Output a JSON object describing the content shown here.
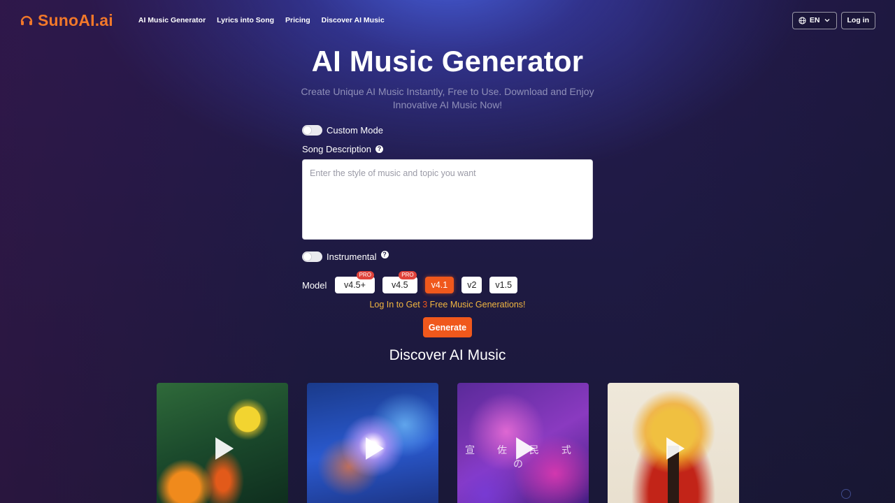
{
  "brand": {
    "name": "SunoAI.ai",
    "accent": "#f2782a"
  },
  "nav": {
    "links": [
      "AI Music Generator",
      "Lyrics into Song",
      "Pricing",
      "Discover AI Music"
    ],
    "lang": "EN",
    "login": "Log in"
  },
  "hero": {
    "title": "AI Music Generator",
    "subtitle": "Create Unique AI Music Instantly, Free to Use. Download and Enjoy Innovative AI Music Now!"
  },
  "form": {
    "custom_mode_label": "Custom Mode",
    "custom_mode_on": false,
    "song_description_label": "Song Description",
    "song_description_placeholder": "Enter the style of music and topic you want",
    "song_description_value": "",
    "instrumental_label": "Instrumental",
    "instrumental_on": false,
    "model_label": "Model",
    "models": [
      {
        "label": "v4.5+",
        "badge": "PRO",
        "active": false
      },
      {
        "label": "v4.5",
        "badge": "PRO",
        "active": false
      },
      {
        "label": "v4.1",
        "badge": "",
        "active": true
      },
      {
        "label": "v2",
        "badge": "",
        "active": false
      },
      {
        "label": "v1.5",
        "badge": "",
        "active": false
      }
    ],
    "promo_pre": "Log In to Get ",
    "promo_num": "3",
    "promo_post": " Free Music Generations!",
    "generate_label": "Generate",
    "generate_color": "#f0581c"
  },
  "discover": {
    "title": "Discover AI Music",
    "cards": [
      {
        "art": "dancers-sun-art",
        "overlay_text": ""
      },
      {
        "art": "blue-spirit-art",
        "overlay_text": ""
      },
      {
        "art": "pink-smoke-art",
        "overlay_text": "宣 佐 民 式 の"
      },
      {
        "art": "tree-sun-art",
        "overlay_text": ""
      }
    ]
  }
}
